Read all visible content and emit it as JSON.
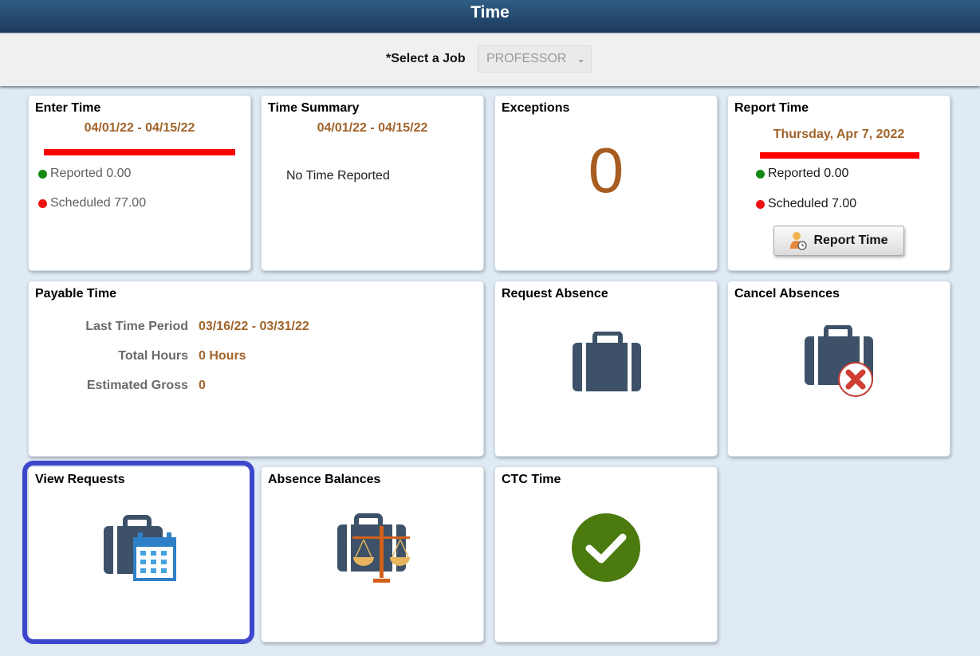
{
  "header": {
    "title": "Time"
  },
  "job_selector": {
    "label": "*Select a Job",
    "value": "PROFESSOR"
  },
  "tiles": {
    "enter_time": {
      "title": "Enter Time",
      "period": "04/01/22 - 04/15/22",
      "reported": "Reported 0.00",
      "scheduled": "Scheduled 77.00"
    },
    "time_summary": {
      "title": "Time Summary",
      "period": "04/01/22 - 04/15/22",
      "message": "No Time Reported"
    },
    "exceptions": {
      "title": "Exceptions",
      "count": "0"
    },
    "report_time": {
      "title": "Report Time",
      "date": "Thursday, Apr 7, 2022",
      "reported": "Reported 0.00",
      "scheduled": "Scheduled 7.00",
      "button_label": "Report Time"
    },
    "payable_time": {
      "title": "Payable Time",
      "rows": [
        {
          "label": "Last Time Period",
          "value": "03/16/22 - 03/31/22"
        },
        {
          "label": "Total Hours",
          "value": "0 Hours"
        },
        {
          "label": "Estimated Gross",
          "value": "0"
        }
      ]
    },
    "request_absence": {
      "title": "Request Absence"
    },
    "cancel_absences": {
      "title": "Cancel Absences"
    },
    "view_requests": {
      "title": "View Requests"
    },
    "absence_balances": {
      "title": "Absence Balances"
    },
    "ctc_time": {
      "title": "CTC Time"
    }
  },
  "colors": {
    "accent_text": "#a0632a",
    "focus_ring": "#3e47cc",
    "status_green": "#138a13",
    "status_red": "#ee1111",
    "briefcase": "#3d5168"
  }
}
